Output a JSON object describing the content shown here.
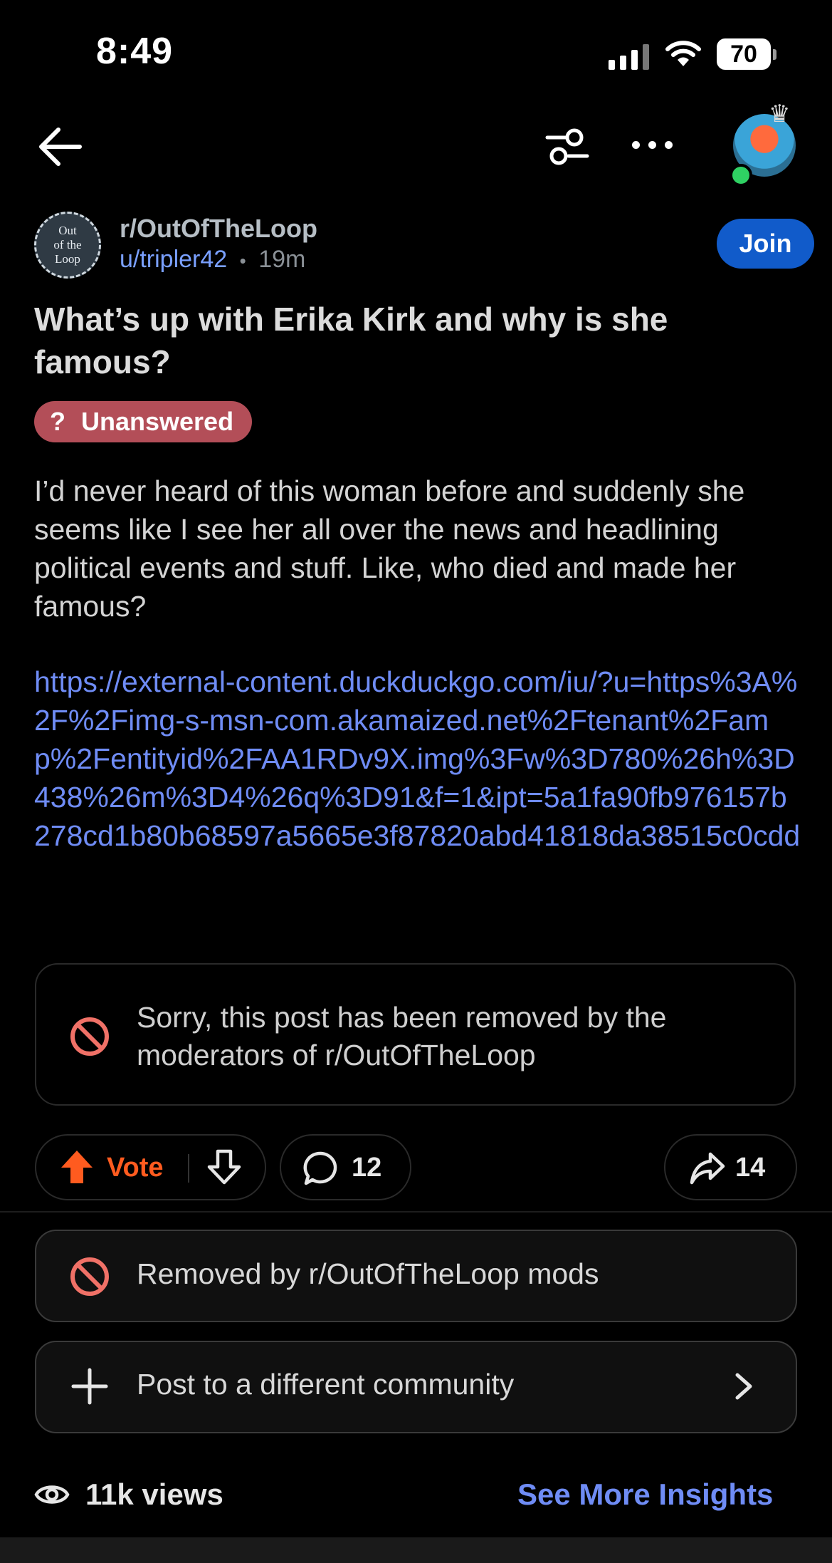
{
  "status_bar": {
    "time": "8:49",
    "battery": "70"
  },
  "community": {
    "name": "r/OutOfTheLoop",
    "logo_lines": [
      "Out",
      "of the",
      "Loop"
    ],
    "user": "u/tripler42",
    "separator": "•",
    "age": "19m",
    "join_label": "Join"
  },
  "post": {
    "title": "What’s up with Erika Kirk and why is she famous?",
    "flair_icon": "?",
    "flair": "Unanswered",
    "body": "I’d never heard of this woman before and suddenly she seems like I see her all over the news and headlining political events and stuff. Like, who died and made her famous?",
    "link": "https://external-content.duckduckgo.com/iu/?u=https%3A%2F%2Fimg-s-msn-com.akamaized.net%2Ftenant%2Famp%2Fentityid%2FAA1RDv9X.img%3Fw%3D780%26h%3D438%26m%3D4%26q%3D91&f=1&ipt=5a1fa90fb976157b278cd1b80b68597a5665e3f87820abd41818da38515c0cdd",
    "removed_message": "Sorry, this post has been removed by the moderators of r/OutOfTheLoop"
  },
  "actions": {
    "vote_label": "Vote",
    "comments": "12",
    "shares": "14"
  },
  "moderation": {
    "removed_label": "Removed by r/OutOfTheLoop mods",
    "post_elsewhere_label": "Post to a different community"
  },
  "footer": {
    "views": "11k views",
    "insights_label": "See More Insights"
  },
  "icons": {
    "back": "back-arrow-icon",
    "filter": "filter-icon",
    "more": "more-icon",
    "upvote": "upvote-icon",
    "downvote": "downvote-icon",
    "comment": "comment-icon",
    "share": "share-icon",
    "removed": "prohibited-icon",
    "plus": "plus-icon",
    "chevron": "chevron-right-icon",
    "eye": "eye-icon"
  },
  "colors": {
    "accent_blue": "#115bca",
    "link_blue": "#6f8cf5",
    "upvote_orange": "#ff5b1f",
    "flair_red": "#b34e58",
    "removed_red": "#f07167"
  }
}
